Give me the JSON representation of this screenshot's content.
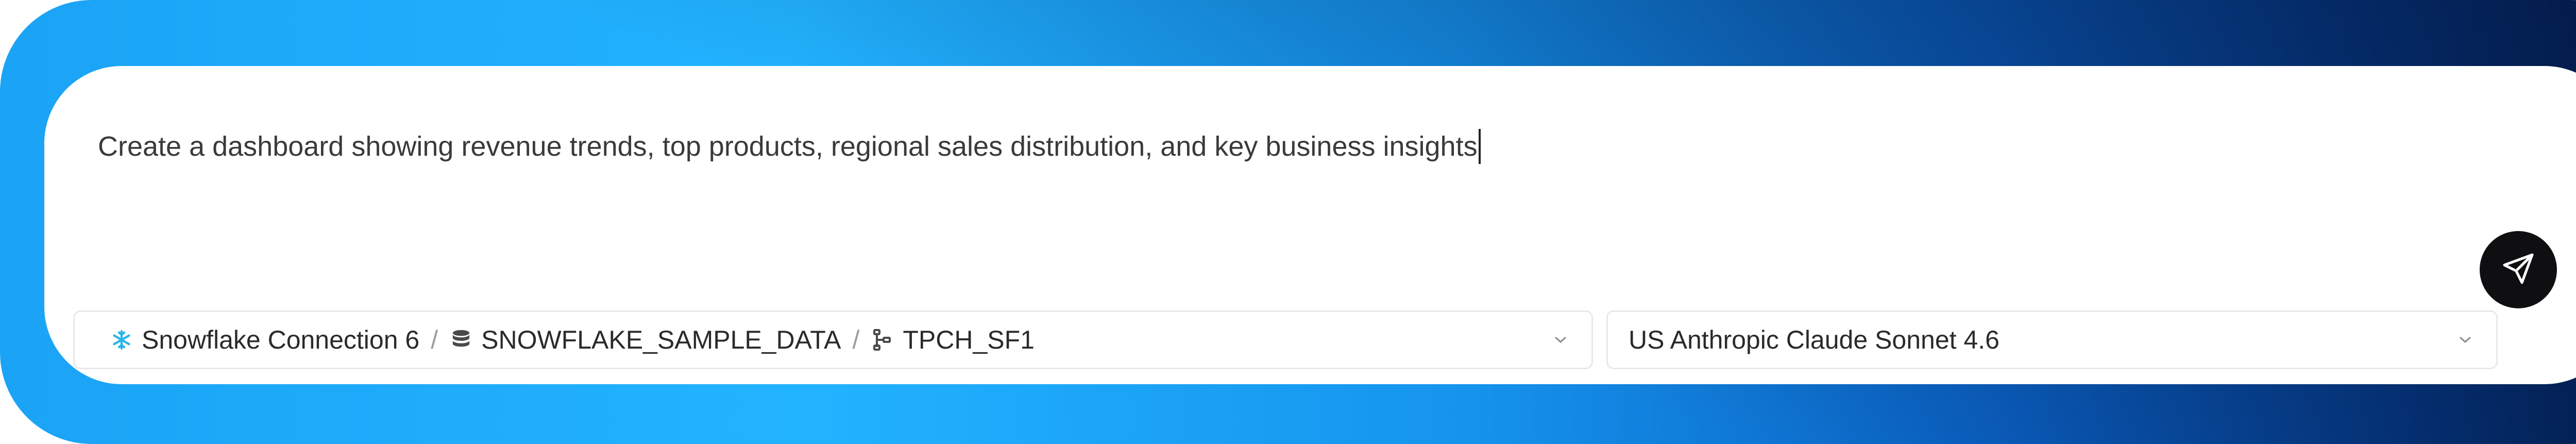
{
  "prompt": {
    "text": "Create a dashboard showing revenue trends, top products, regional sales distribution, and key business insights"
  },
  "connection_selector": {
    "connection": "Snowflake Connection 6",
    "database": "SNOWFLAKE_SAMPLE_DATA",
    "schema": "TPCH_SF1",
    "separator": "/",
    "icons": [
      "snowflake-icon",
      "database-icon",
      "schema-icon",
      "chevron-down-icon"
    ]
  },
  "model_selector": {
    "value": "US Anthropic Claude Sonnet 4.6",
    "icon": "chevron-down-icon"
  },
  "send_button": {
    "icon": "send-icon"
  },
  "colors": {
    "frame_gradient_start": "#1ba3f5",
    "frame_gradient_end": "#021d4d",
    "snowflake_icon": "#29b5e8",
    "send_button_bg": "#0f0f12"
  }
}
